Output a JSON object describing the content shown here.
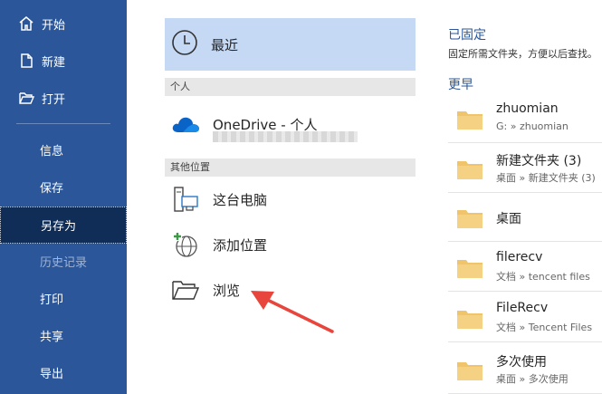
{
  "sidebar": {
    "top_items": [
      {
        "label": "开始",
        "icon": "home-icon"
      },
      {
        "label": "新建",
        "icon": "new-document-icon"
      },
      {
        "label": "打开",
        "icon": "open-folder-icon"
      }
    ],
    "items": [
      {
        "label": "信息"
      },
      {
        "label": "保存"
      },
      {
        "label": "另存为",
        "active": true
      },
      {
        "label": "历史记录",
        "disabled": true
      },
      {
        "label": "打印"
      },
      {
        "label": "共享"
      },
      {
        "label": "导出"
      }
    ]
  },
  "locations": {
    "recent": {
      "label": "最近",
      "icon": "clock-icon"
    },
    "personal_header": "个人",
    "onedrive": {
      "label": "OneDrive - 个人",
      "icon": "onedrive-cloud-icon"
    },
    "other_header": "其他位置",
    "this_pc": {
      "label": "这台电脑",
      "icon": "computer-icon"
    },
    "add_place": {
      "label": "添加位置",
      "icon": "add-place-globe-icon"
    },
    "browse": {
      "label": "浏览",
      "icon": "folder-open-icon"
    }
  },
  "recent_panel": {
    "pinned_title": "已固定",
    "pinned_desc": "固定所需文件夹，方便以后查找。",
    "older_title": "更早",
    "folders": [
      {
        "name": "zhuomian",
        "path": "G: » zhuomian"
      },
      {
        "name": "新建文件夹 (3)",
        "path": "桌面 » 新建文件夹 (3)"
      },
      {
        "name": "桌面",
        "path": ""
      },
      {
        "name": "filerecv",
        "path": "文档 » tencent files"
      },
      {
        "name": "FileRecv",
        "path": "文档 » Tencent Files"
      },
      {
        "name": "多次使用",
        "path": "桌面 » 多次使用"
      }
    ]
  },
  "colors": {
    "sidebar": "#2b579a",
    "sidebar_active": "#0f2d57",
    "selected_location": "#c5d9f5",
    "folder": "#f0c46a",
    "annotation_arrow": "#e8453c"
  }
}
